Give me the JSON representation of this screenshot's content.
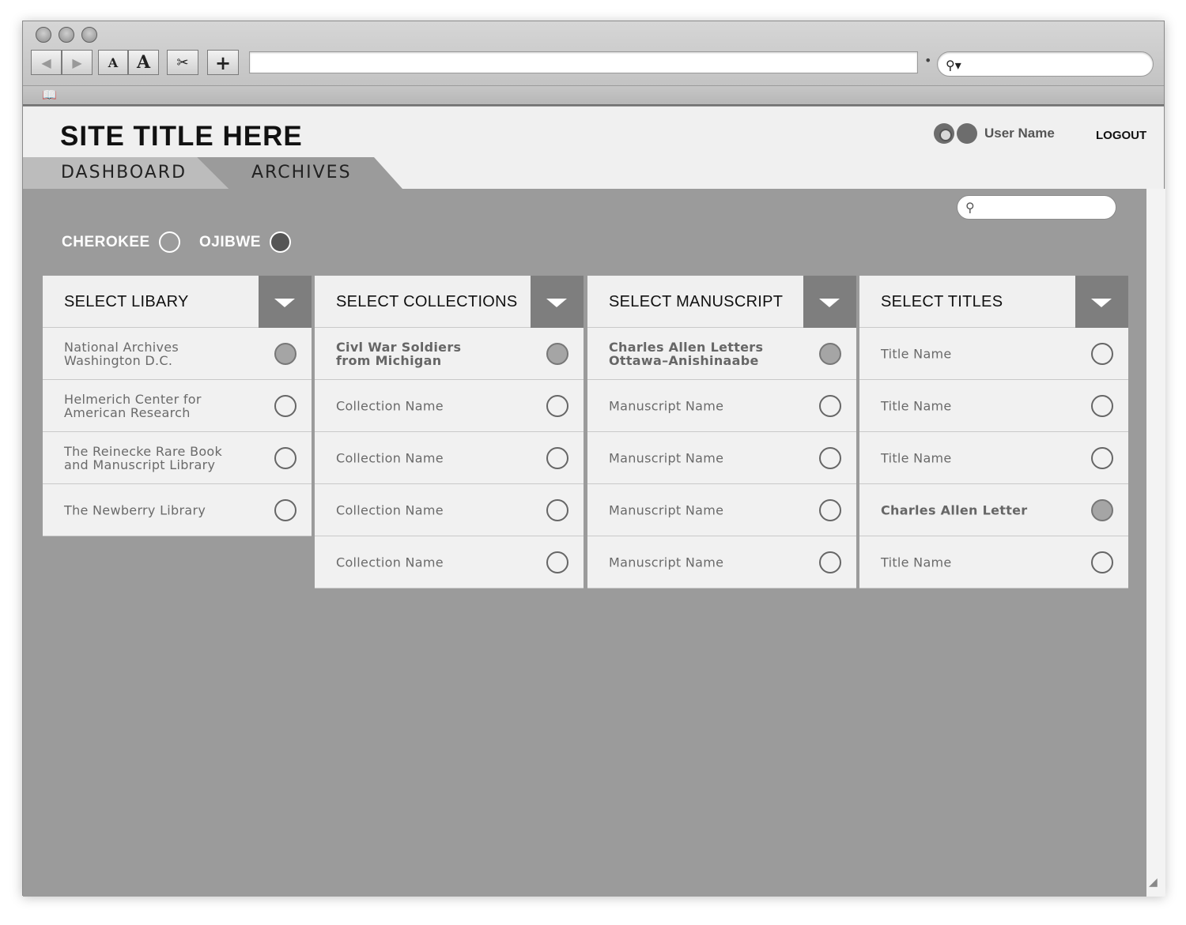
{
  "browser": {
    "url": "",
    "search_placeholder": ""
  },
  "header": {
    "site_title": "SITE TITLE HERE",
    "user_name": "User Name",
    "logout_label": "LOGOUT"
  },
  "tabs": [
    {
      "label": "DASHBOARD",
      "active": false
    },
    {
      "label": "ARCHIVES",
      "active": true
    }
  ],
  "content_search": {
    "placeholder": ""
  },
  "languages": [
    {
      "label": "CHEROKEE",
      "selected": false
    },
    {
      "label": "OJIBWE",
      "selected": true
    }
  ],
  "columns": [
    {
      "title": "SELECT LIBARY",
      "rows": [
        {
          "text": "National Archives\nWashington D.C.",
          "selected": true
        },
        {
          "text": "Helmerich Center for\nAmerican Research",
          "selected": false
        },
        {
          "text": "The Reinecke Rare Book\nand Manuscript Library",
          "selected": false
        },
        {
          "text": "The Newberry Library",
          "selected": false
        }
      ]
    },
    {
      "title": "SELECT COLLECTIONS",
      "rows": [
        {
          "text": "Civl War Soldiers\nfrom Michigan",
          "selected": true
        },
        {
          "text": "Collection Name",
          "selected": false
        },
        {
          "text": "Collection Name",
          "selected": false
        },
        {
          "text": "Collection Name",
          "selected": false
        },
        {
          "text": "Collection Name",
          "selected": false
        }
      ]
    },
    {
      "title": "SELECT MANUSCRIPT",
      "rows": [
        {
          "text": "Charles Allen Letters\nOttawa–Anishinaabe",
          "selected": true
        },
        {
          "text": "Manuscript Name",
          "selected": false
        },
        {
          "text": "Manuscript Name",
          "selected": false
        },
        {
          "text": "Manuscript Name",
          "selected": false
        },
        {
          "text": "Manuscript Name",
          "selected": false
        }
      ]
    },
    {
      "title": "SELECT TITLES",
      "rows": [
        {
          "text": "Title Name",
          "selected": false
        },
        {
          "text": "Title Name",
          "selected": false
        },
        {
          "text": "Title Name",
          "selected": false
        },
        {
          "text": "Charles Allen Letter",
          "selected": true
        },
        {
          "text": "Title Name",
          "selected": false
        }
      ]
    }
  ]
}
